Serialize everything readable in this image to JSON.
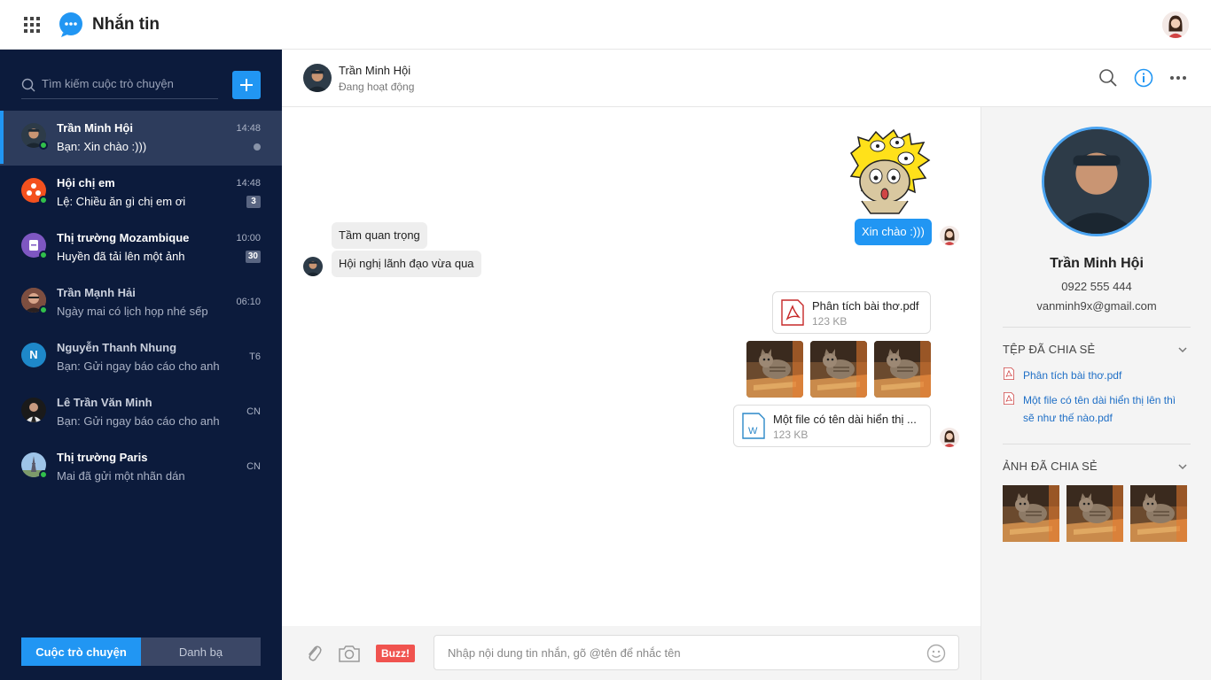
{
  "app": {
    "title": "Nhắn tin"
  },
  "sidebar": {
    "search_placeholder": "Tìm kiếm cuộc trò chuyện",
    "conversations": [
      {
        "name": "Trần Minh Hội",
        "message": "Bạn: Xin chào :)))",
        "time": "14:48",
        "badge": "",
        "online": true
      },
      {
        "name": "Hội chị em",
        "message": "Lệ: Chiều ăn gì chị em ơi",
        "time": "14:48",
        "badge": "3",
        "online": true
      },
      {
        "name": "Thị trường Mozambique",
        "message": "Huyền đã tải lên một ảnh",
        "time": "10:00",
        "badge": "30",
        "online": true
      },
      {
        "name": "Trần Mạnh Hải",
        "message": "Ngày mai có lịch họp nhé sếp",
        "time": "06:10",
        "badge": "",
        "online": true
      },
      {
        "name": "Nguyễn Thanh Nhung",
        "message": "Bạn: Gửi ngay báo cáo cho anh",
        "time": "T6",
        "badge": "",
        "online": false,
        "initial": "N"
      },
      {
        "name": "Lê Trần Văn Minh",
        "message": "Bạn: Gửi ngay báo cáo cho anh",
        "time": "CN",
        "badge": "",
        "online": false
      },
      {
        "name": "Thị trường Paris",
        "message": "Mai đã gửi một nhãn dán",
        "time": "CN",
        "badge": "",
        "online": true
      }
    ],
    "tabs": [
      "Cuộc trò chuyện",
      "Danh bạ"
    ]
  },
  "chat": {
    "contact_name": "Trần Minh Hội",
    "contact_status": "Đang hoạt động",
    "messages": {
      "out_text": "Xin chào :)))",
      "in_1": "Tầm quan trọng",
      "in_2": "Hội nghị lãnh đạo vừa qua",
      "file_1": {
        "name": "Phân tích bài thơ.pdf",
        "size": "123 KB"
      },
      "file_2": {
        "name": "Một file có tên dài hiển thị ...",
        "size": "123 KB"
      }
    },
    "composer": {
      "buzz_label": "Buzz!",
      "placeholder": "Nhập nội dung tin nhắn, gõ @tên để nhắc tên"
    }
  },
  "info": {
    "name": "Trần Minh Hội",
    "phone": "0922 555 444",
    "email": "vanminh9x@gmail.com",
    "files_section": "TỆP ĐÃ CHIA SẺ",
    "shared_files": [
      "Phân tích bài thơ.pdf",
      "Một file có tên dài hiển thị lên thì sẽ như thế nào.pdf"
    ],
    "photos_section": "ẢNH ĐÃ CHIA SẺ"
  },
  "colors": {
    "accent": "#2196f3",
    "sidebar_bg": "#0c1b3c",
    "online": "#31c04b",
    "buzz": "#f0534f",
    "link": "#1f6fc6"
  },
  "icons": [
    "apps-grid-icon",
    "chat-bubble-icon",
    "search-icon",
    "plus-icon",
    "info-icon",
    "more-icon",
    "attach-icon",
    "camera-icon",
    "emoji-icon",
    "pdf-icon",
    "word-icon",
    "chevron-down-icon"
  ]
}
